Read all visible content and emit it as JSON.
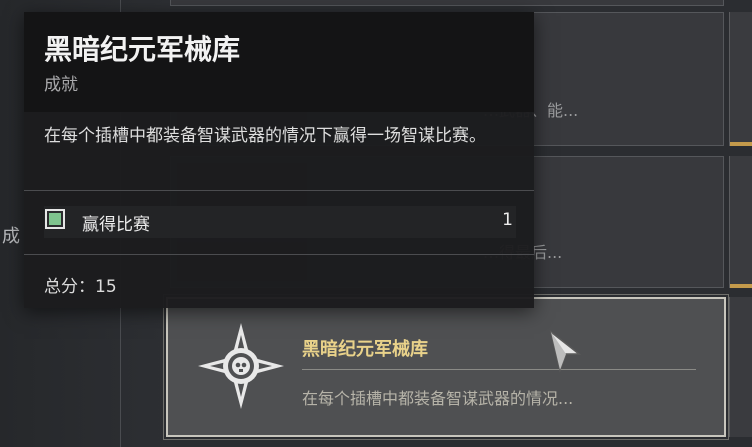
{
  "left_panel": {
    "partial_label": "成"
  },
  "cards": [
    {
      "description": "…武器、能..."
    },
    {
      "description": "…得最后..."
    }
  ],
  "selected_card": {
    "title": "黑暗纪元军械库",
    "description": "在每个插槽中都装备智谋武器的情况..."
  },
  "tooltip": {
    "title": "黑暗纪元军械库",
    "subtitle": "成就",
    "description": "在每个插槽中都装备智谋武器的情况下赢得一场智谋比赛。",
    "objective": {
      "label": "赢得比赛",
      "count": "1",
      "completed": true
    },
    "score": "总分：15"
  },
  "colors": {
    "accent_gold": "#e9d28a",
    "objective_complete": "#7fc48e",
    "edge_gold": "#c49a4b"
  }
}
